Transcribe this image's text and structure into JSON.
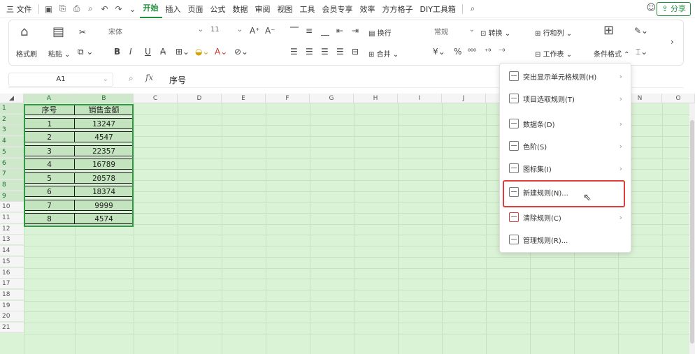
{
  "menubar": {
    "items": [
      "三 文件",
      "开始",
      "插入",
      "页面",
      "公式",
      "数据",
      "审阅",
      "视图",
      "工具",
      "会员专享",
      "效率",
      "方方格子",
      "DIY工具箱"
    ],
    "active_index": 1,
    "share_label": "分享"
  },
  "ribbon": {
    "format_painter": "格式刷",
    "paste": "粘贴",
    "font_name": "宋体",
    "font_size": "11",
    "wrap": "换行",
    "number_format": "常规",
    "convert": "转换",
    "merge": "合并",
    "rows_cols": "行和列",
    "worksheet": "工作表",
    "cond_format": "条件格式",
    "font_grow": "A⁺",
    "font_shrink": "A⁻",
    "bold": "B",
    "italic": "I",
    "underline": "U",
    "strike": "A",
    "yen": "¥",
    "percent": "%"
  },
  "formula_bar": {
    "name_box": "A1",
    "fx": "fx",
    "content": "序号"
  },
  "sheet": {
    "columns": [
      "A",
      "B",
      "C",
      "D",
      "E",
      "F",
      "G",
      "H",
      "I",
      "J",
      "K",
      "L",
      "M",
      "N",
      "O"
    ],
    "rows": [
      "1",
      "2",
      "3",
      "4",
      "5",
      "6",
      "7",
      "8",
      "9",
      "10",
      "11",
      "12",
      "13",
      "14",
      "15",
      "16",
      "17",
      "18",
      "19",
      "20",
      "21"
    ],
    "header": [
      "序号",
      "销售金额"
    ],
    "data": [
      [
        "1",
        "13247"
      ],
      [
        "2",
        "4547"
      ],
      [
        "3",
        "22357"
      ],
      [
        "4",
        "16789"
      ],
      [
        "5",
        "20578"
      ],
      [
        "6",
        "18374"
      ],
      [
        "7",
        "9999"
      ],
      [
        "8",
        "4574"
      ]
    ]
  },
  "dropdown": {
    "items": [
      {
        "label": "突出显示单元格规则(H)",
        "submenu": true,
        "icon": "highlight-rules-icon"
      },
      {
        "label": "项目选取规则(T)",
        "submenu": true,
        "icon": "top-bottom-icon"
      },
      {
        "label": "数据条(D)",
        "submenu": true,
        "icon": "data-bar-icon"
      },
      {
        "label": "色阶(S)",
        "submenu": true,
        "icon": "color-scale-icon"
      },
      {
        "label": "图标集(I)",
        "submenu": true,
        "icon": "icon-set-icon"
      },
      {
        "label": "新建规则(N)...",
        "submenu": false,
        "icon": "new-rule-icon"
      },
      {
        "label": "清除规则(C)",
        "submenu": true,
        "icon": "clear-rules-icon"
      },
      {
        "label": "管理规则(R)...",
        "submenu": false,
        "icon": "manage-rules-icon"
      }
    ],
    "highlighted_index": 5,
    "highlight_color": "#e03c3c"
  },
  "colors": {
    "accent": "#1f8f3a",
    "sheet_bg": "#daf2d5"
  }
}
